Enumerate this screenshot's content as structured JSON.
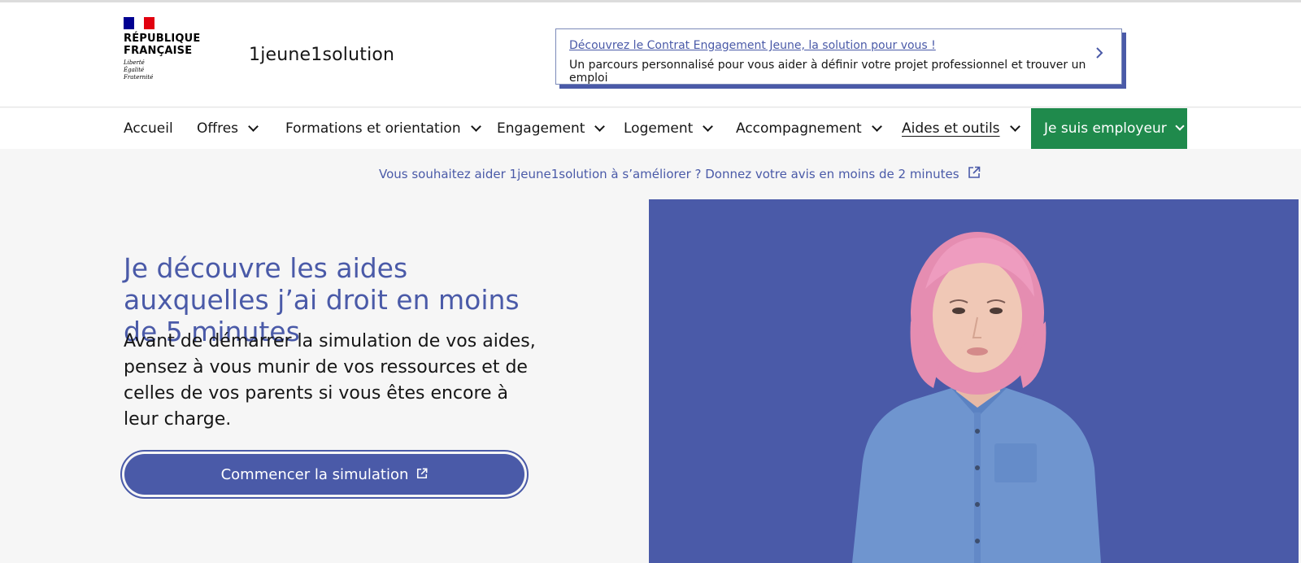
{
  "header": {
    "logo": {
      "line1": "RÉPUBLIQUE",
      "line2": "FRANÇAISE",
      "motto": [
        "Liberté",
        "Égalité",
        "Fraternité"
      ],
      "flag_colors": [
        "#000091",
        "#ffffff",
        "#e1000f"
      ]
    },
    "brand": "1jeune1solution",
    "promo": {
      "title": "Découvrez le Contrat Engagement Jeune, la solution pour vous !",
      "text": "Un parcours personnalisé pour vous aider à définir votre projet professionnel et trouver un emploi",
      "arrow_icon": "chevron-right-icon"
    }
  },
  "nav": {
    "items": [
      {
        "label": "Accueil"
      },
      {
        "label": "Offres"
      },
      {
        "label": "Formations et orientation"
      },
      {
        "label": "Engagement"
      },
      {
        "label": "Logement"
      },
      {
        "label": "Accompagnement"
      },
      {
        "label": "Aides et outils"
      }
    ],
    "employer": "Je suis employeur",
    "employer_color": "#1f8a4c"
  },
  "feedback": {
    "text": "Vous souhaitez aider 1jeune1solution à s’améliorer ? Donnez votre avis en moins de 2 minutes",
    "icon": "external-link-icon"
  },
  "hero": {
    "title": "Je découvre les aides auxquelles j’ai droit en moins de 5 minutes",
    "text": "Avant de démarrer la simulation de vos aides, pensez à vous munir de vos ressources et de celles de vos parents si vous êtes encore à leur charge.",
    "cta": "Commencer la simulation",
    "accent_color": "#4a5aa8"
  }
}
